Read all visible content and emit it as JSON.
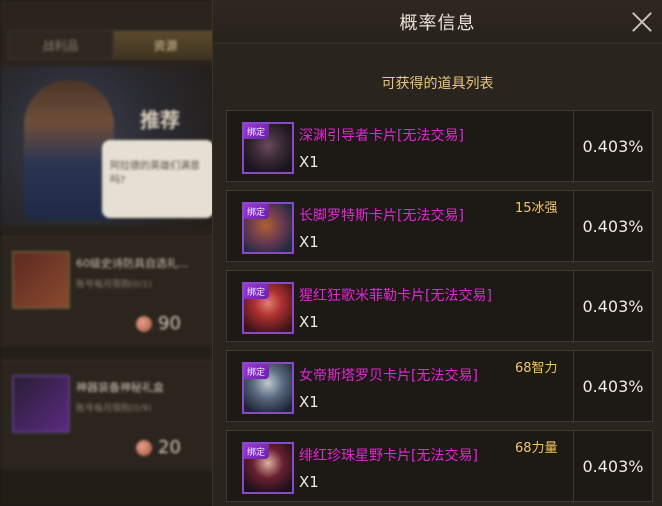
{
  "background_shop": {
    "tabs": [
      "战利品",
      "资源"
    ],
    "banner_title": "推荐",
    "bubble_text": "阿拉德的英雄们满意吗?",
    "items": [
      {
        "name": "60级史诗防具自选礼...",
        "limit": "账号每月限购(0/1)",
        "price": "90"
      },
      {
        "name": "神器装备神秘礼盒",
        "limit": "账号每月限购(0/9)",
        "price": "20"
      }
    ]
  },
  "popup": {
    "title": "概率信息",
    "list_heading": "可获得的道具列表",
    "bound_label": "绑定",
    "items": [
      {
        "name": "深渊引导者卡片[无法交易]",
        "qty": "X1",
        "tag": "",
        "probability": "0.403%"
      },
      {
        "name": "长脚罗特斯卡片[无法交易]",
        "qty": "X1",
        "tag": "15冰强",
        "probability": "0.403%"
      },
      {
        "name": "猩红狂歌米菲勒卡片[无法交易]",
        "qty": "X1",
        "tag": "",
        "probability": "0.403%"
      },
      {
        "name": "女帝斯塔罗贝卡片[无法交易]",
        "qty": "X1",
        "tag": "68智力",
        "probability": "0.403%"
      },
      {
        "name": "绯红珍珠星野卡片[无法交易]",
        "qty": "X1",
        "tag": "68力量",
        "probability": "0.403%"
      }
    ]
  },
  "colors": {
    "item_name": "#e326d6",
    "tag": "#f1c66a",
    "heading": "#e9c77f",
    "bound_purple": "#9a3ae0"
  }
}
